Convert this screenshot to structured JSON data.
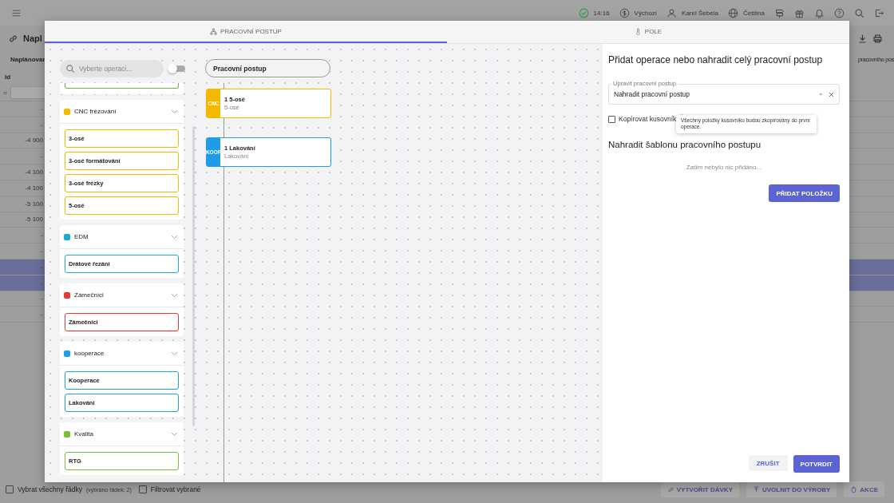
{
  "app": {
    "time": "14:16",
    "currency": "Výchozí",
    "user": "Karel Šebela",
    "language": "Čeština",
    "page_title": "Napl",
    "columns": [
      "Naplánovan",
      "pracovního pos"
    ],
    "id_header": "Id",
    "filter_operator": "=",
    "rows": [
      {
        "value": "-",
        "selected": false
      },
      {
        "value": "-",
        "selected": false
      },
      {
        "value": "-4 900",
        "selected": false
      },
      {
        "value": "-",
        "selected": false
      },
      {
        "value": "-4 100",
        "selected": false
      },
      {
        "value": "-4 100",
        "selected": false
      },
      {
        "value": "-5 100",
        "selected": false
      },
      {
        "value": "-5 100",
        "selected": false
      },
      {
        "value": "-",
        "selected": false
      },
      {
        "value": "-",
        "selected": false
      },
      {
        "value": "-",
        "selected": true
      },
      {
        "value": "-",
        "selected": true
      },
      {
        "value": "-",
        "selected": false
      },
      {
        "value": "-",
        "selected": false
      }
    ],
    "footer": {
      "select_all": {
        "label": "Vybrat všechny řádky",
        "note": "(vybráno řádek: 2)",
        "checked": false
      },
      "filter_selected": {
        "label": "Filtrovat vybrané",
        "checked": false
      },
      "buttons": [
        "VYTVOŘIT DÁVKY",
        "UVOLNIT DO VÝROBY",
        "AKCE"
      ]
    }
  },
  "dialog": {
    "tabs": [
      {
        "label": "PRACOVNÍ POSTUP",
        "selected": true
      },
      {
        "label": "POLE",
        "selected": false
      }
    ],
    "search": {
      "placeholder": "Vyberte operaci..."
    },
    "toggle": {
      "on": false
    },
    "workflow_button": "Pracovní postup",
    "cut_item": {
      "color": "#6cb34a"
    },
    "groups": [
      {
        "name": "CNC frézování",
        "color": "#f5b800",
        "items": [
          "3-osé",
          "3-osé formátování",
          "3-osé frézky",
          "5-osé"
        ]
      },
      {
        "name": "EDM",
        "color": "#17aecb",
        "items": [
          "Drátové řezání"
        ]
      },
      {
        "name": "Zámečníci",
        "color": "#e53935",
        "items": [
          "Zámečníci"
        ]
      },
      {
        "name": "kooperace",
        "color": "#1e9be9",
        "items": [
          "Kooperace",
          "Lakování"
        ]
      },
      {
        "name": "Kvalita",
        "color": "#7cbf3c",
        "items": [
          "RTG"
        ]
      }
    ],
    "nodes": [
      {
        "code": "CNC",
        "title": "1 5-osé",
        "subtitle": "5-osé",
        "color": "#f5b800"
      },
      {
        "code": "KOOP",
        "title": "1 Lakování",
        "subtitle": "Lakování",
        "color": "#1e9be9"
      }
    ],
    "panel": {
      "title": "Přidat operace nebo nahradit celý pracovní postup",
      "select": {
        "label": "Upravit pracovní postup",
        "value": "Nahradit pracovní postup"
      },
      "copy_bom": {
        "label": "Kopírovat kusovník",
        "checked": false
      },
      "tooltip": "Všechny položky kusovníku budou zkopírovány do první operace.",
      "template_title": "Nahradit šablonu pracovního postupu",
      "empty": "Zatím nebylo nic přidáno...",
      "add_button": "PŘIDAT POLOŽKU",
      "cancel_button": "ZRUŠIT",
      "confirm_button": "POTVRDIT"
    }
  }
}
